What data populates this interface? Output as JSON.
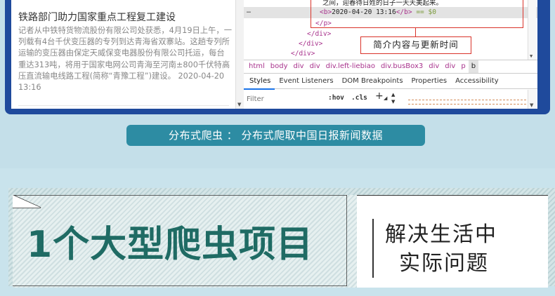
{
  "news": {
    "title": "铁路部门助力国家重点工程复工建设",
    "body": "记者从中铁特货物流股份有限公司处获悉，4月19日上午，一列载有4台千伏变压器的专列到达青海省双寨站。这趟专列所运输的变压器由保定天威保变电器股份有限公司托运，每台重达313吨，将用于国家电网公司青海至河南±800千伏特高压直流输电线路工程(简称“青豫工程”)建设。",
    "date": "2020-04-20 13:16"
  },
  "devtools": {
    "code_line_1": "之间，迎春待日姓的日子一天天美起来。",
    "ellipsis": "…",
    "code_line_2": {
      "open_tag": "<b>",
      "text": "2020-04-20 13:16",
      "close_tag": "</b>",
      "console_ref": "== $0"
    },
    "code_line_3": "</p>",
    "code_line_4": "</div>",
    "code_line_5": "</div>",
    "code_line_6": "</div>",
    "annotation": "简介内容与更新时间",
    "breadcrumbs": [
      "html",
      "body",
      "div",
      "div",
      "div.left-liebiao",
      "div.busBox3",
      "div",
      "div",
      "p",
      "b"
    ],
    "tabs": [
      "Styles",
      "Event Listeners",
      "DOM Breakpoints",
      "Properties",
      "Accessibility"
    ],
    "active_tab": "Styles",
    "filter_placeholder": "Filter",
    "hov_label": ":hov",
    "cls_label": ".cls",
    "plus_label": "+"
  },
  "caption": "分布式爬虫 ： 分布式爬取中国日报新闻数据",
  "banner": {
    "title": "1个大型爬虫项目",
    "subtitle_line1": "解决生活中",
    "subtitle_line2": "实际问题"
  },
  "colors": {
    "frame": "#1f4a9c",
    "caption_bg": "#2d8ca3",
    "title_green": "#1f6b64",
    "annotation_red": "#d9332a",
    "tag_purple": "#a8328c"
  }
}
